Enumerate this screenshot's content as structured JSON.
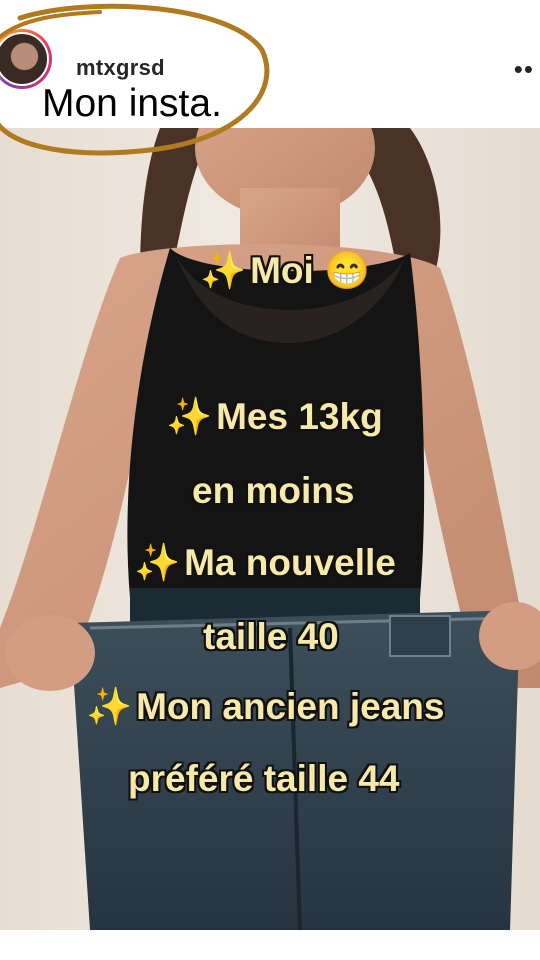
{
  "post": {
    "username": "mtxgrsd",
    "caption": "Mon insta.",
    "more_icon": "more-dots-icon"
  },
  "overlay": {
    "line1_emoji": "✨",
    "line1_text": "Moi",
    "line1_end_emoji": "😁",
    "line2_emoji": "✨",
    "line2_text": "Mes 13kg",
    "line3_text": "en moins",
    "line4_emoji": "✨",
    "line4_text": "Ma nouvelle",
    "line5_text": "taille 40",
    "line6_emoji": "✨",
    "line6_text": "Mon ancien jeans",
    "line7_text": "préféré taille 44"
  },
  "colors": {
    "overlay_text": "#f6e9a9",
    "annotation_circle": "#b07a1e"
  }
}
